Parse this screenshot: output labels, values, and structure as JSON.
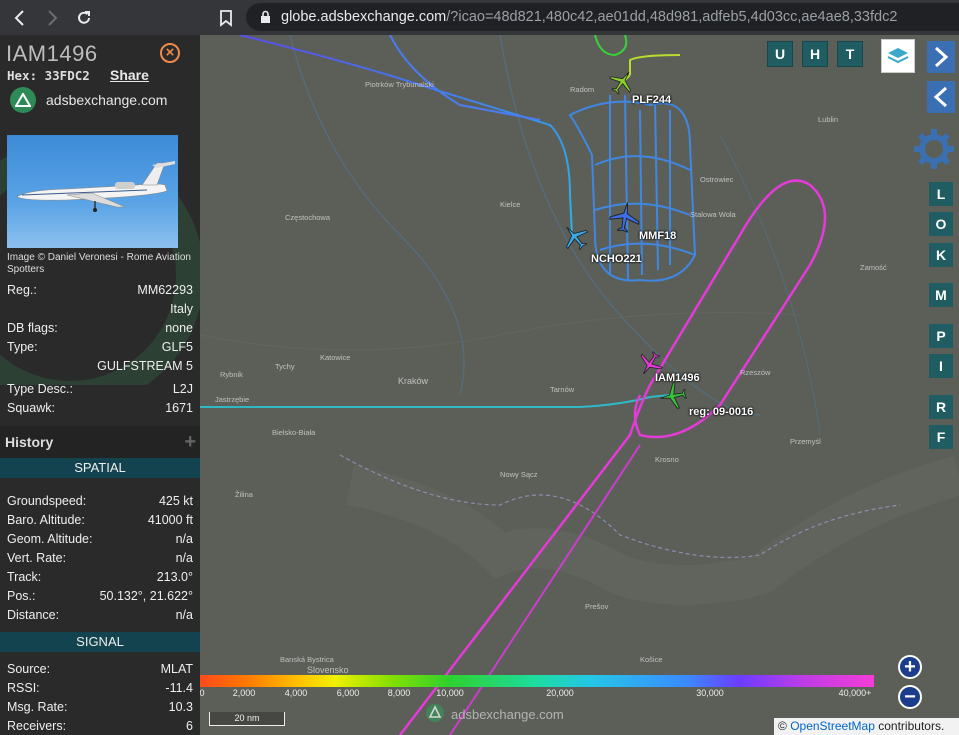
{
  "browser": {
    "url_host": "globe.adsbexchange.com",
    "url_rest": "/?icao=48d821,480c42,ae01dd,48d981,adfeb5,4d03cc,ae4ae8,33fdc2"
  },
  "sidebar": {
    "title": "IAM1496",
    "hex_label": "Hex: 33FDC2",
    "share_label": "Share",
    "site_link": "adsbexchange.com",
    "photo_credit": "Image © Daniel Veronesi - Rome Aviation Spotters",
    "details": [
      {
        "label": "Reg.:",
        "value": "MM62293"
      },
      {
        "label": "",
        "value": "Italy"
      },
      {
        "label": "DB flags:",
        "value": "none"
      },
      {
        "label": "Type:",
        "value": "GLF5"
      },
      {
        "label": "",
        "value": "GULFSTREAM 5"
      },
      {
        "label": "Type Desc.:",
        "value": "L2J"
      },
      {
        "label": "Squawk:",
        "value": "1671"
      }
    ],
    "history_label": "History",
    "spatial_header": "SPATIAL",
    "spatial": [
      {
        "label": "Groundspeed:",
        "value": "425 kt"
      },
      {
        "label": "Baro. Altitude:",
        "value": "41000 ft"
      },
      {
        "label": "Geom. Altitude:",
        "value": "n/a"
      },
      {
        "label": "Vert. Rate:",
        "value": "n/a"
      },
      {
        "label": "Track:",
        "value": "213.0°"
      },
      {
        "label": "Pos.:",
        "value": "50.132°, 21.622°"
      },
      {
        "label": "Distance:",
        "value": "n/a"
      }
    ],
    "signal_header": "SIGNAL",
    "signal": [
      {
        "label": "Source:",
        "value": "MLAT"
      },
      {
        "label": "RSSI:",
        "value": "-11.4"
      },
      {
        "label": "Msg. Rate:",
        "value": "10.3"
      },
      {
        "label": "Receivers:",
        "value": "6"
      }
    ]
  },
  "map": {
    "top_buttons": [
      "U",
      "H",
      "T"
    ],
    "side_buttons": [
      "L",
      "O",
      "K",
      "M",
      "P",
      "I",
      "R",
      "F"
    ],
    "aircraft_labels": {
      "plf": "PLF244",
      "mmf": "MMF18",
      "ncho": "NCHO221",
      "iam": "IAM1496",
      "reg": "reg: 09-0016"
    },
    "place_names": {
      "radom": "Radom",
      "kielce": "Kielce",
      "krakow": "Kraków",
      "tarnow": "Tarnów",
      "rzeszow": "Rzeszów",
      "przemysl": "Przemyśl",
      "krosno": "Krosno",
      "nowy_sacz": "Nowy Sącz",
      "bielsko": "Bielsko-Biała",
      "presov": "Prešov",
      "zilina": "Žilina",
      "slovensko": "Slovensko",
      "lublin": "Lublin",
      "zamosc": "Zamość",
      "czestochowa": "Częstochowa",
      "tychy": "Tychy",
      "rybnik": "Rybnik",
      "katowice": "Katowice",
      "jastrzebie": "Jastrzębie",
      "ostrowiec": "Ostrowiec",
      "stalowa": "Stalowa Wola",
      "piotrkow": "Piotrków Trybunalski",
      "banska": "Banská Bystrica",
      "kosice": "Košice"
    },
    "altitude_legend": [
      "0",
      "2,000",
      "4,000",
      "6,000",
      "8,000",
      "10,000",
      "20,000",
      "30,000",
      "40,000+"
    ],
    "scale_label": "20 nm",
    "watermark": "adsbexchange.com",
    "attribution_prefix": "©",
    "attribution_link": "OpenStreetMap",
    "attribution_suffix": "contributors.",
    "zoom_in": "+",
    "zoom_out": "−"
  }
}
